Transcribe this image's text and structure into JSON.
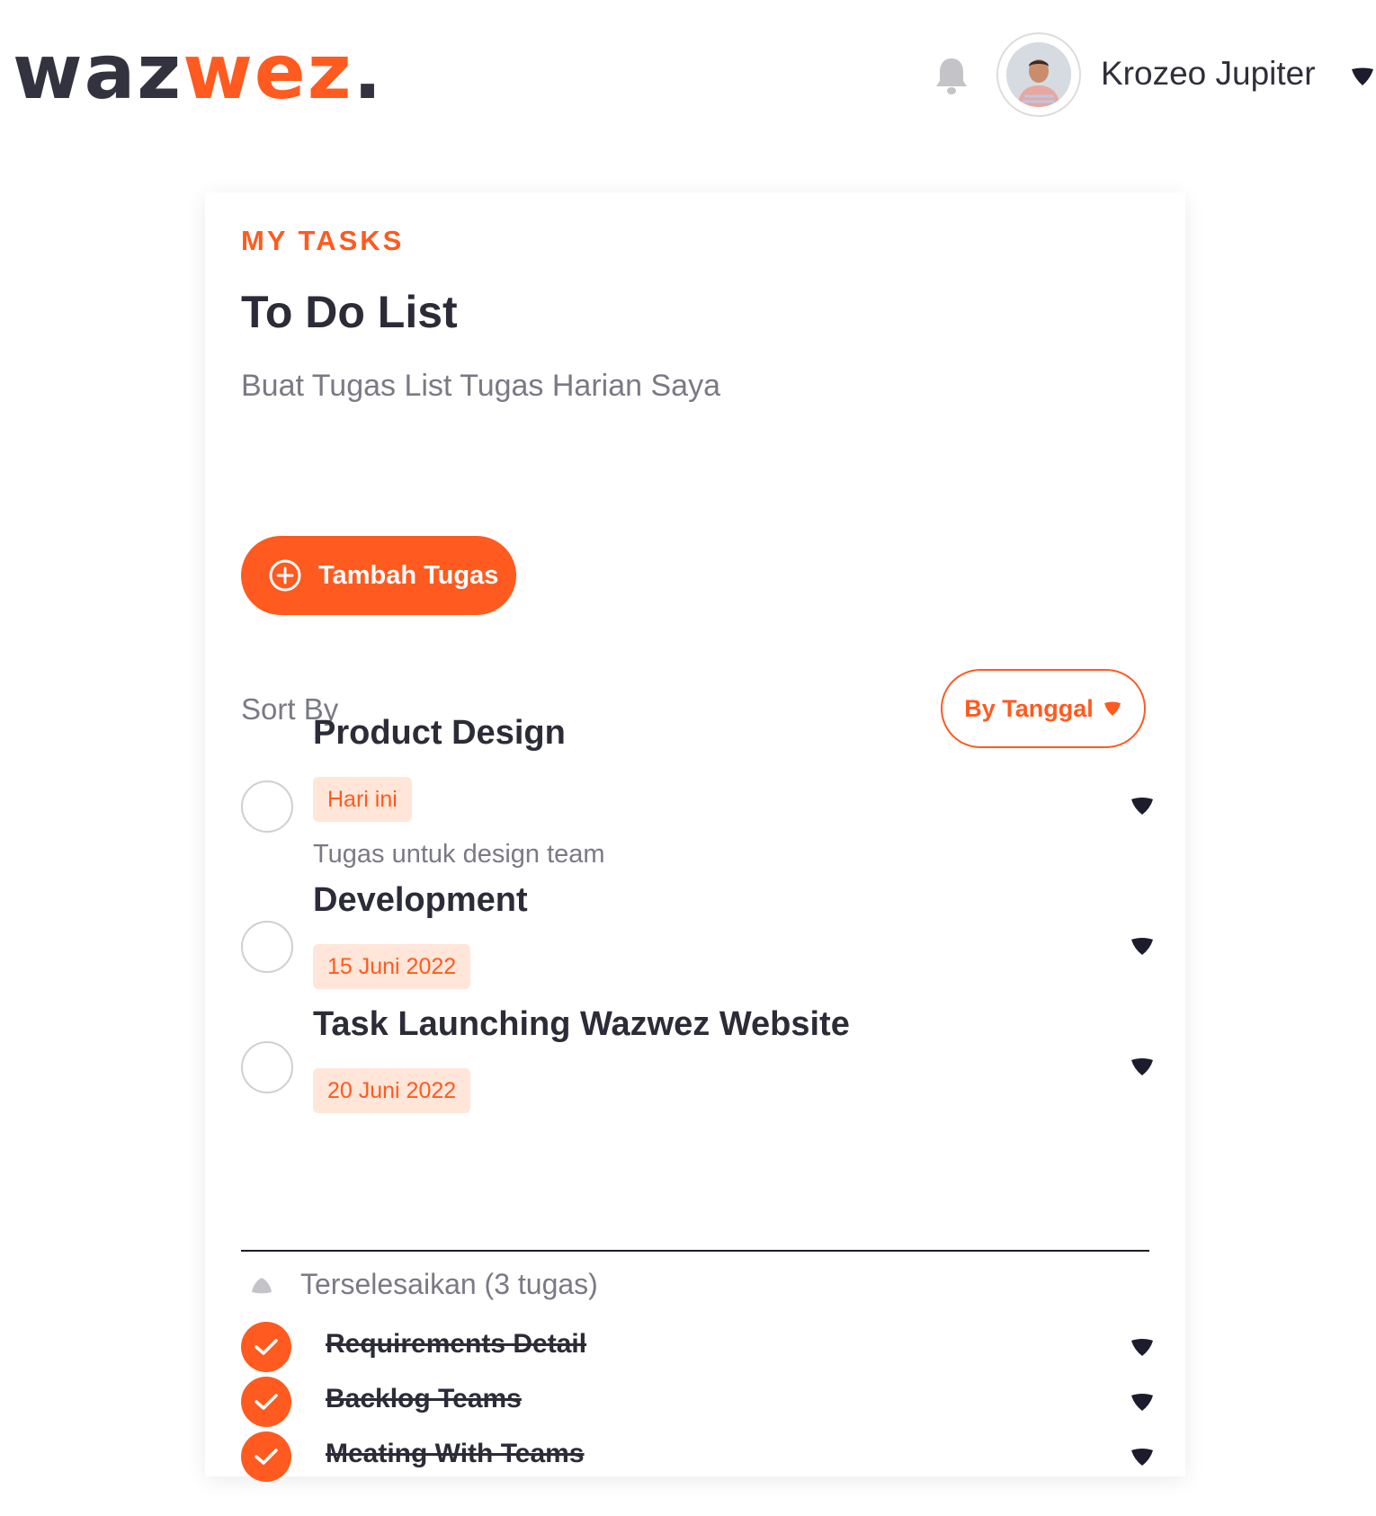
{
  "header": {
    "logo_part1": "waz",
    "logo_part2": "wez",
    "logo_dot": ".",
    "user_name": "Krozeo Jupiter",
    "icons": [
      "bell-icon",
      "avatar",
      "caret-down-icon"
    ]
  },
  "card": {
    "eyebrow": "MY TASKS",
    "title": "To Do List",
    "subtitle": "Buat Tugas List Tugas Harian Saya",
    "add_button_label": "Tambah Tugas",
    "sort_label": "Sort By",
    "sort_value": "By Tanggal"
  },
  "tasks": [
    {
      "name": "Product Design",
      "date": "Hari ini",
      "description": "Tugas untuk design team"
    },
    {
      "name": "Development",
      "date": "15 Juni 2022"
    },
    {
      "name": "Task Launching Wazwez Website",
      "date": "20 Juni 2022"
    }
  ],
  "completed": {
    "label": "Terselesaikan (3 tugas)",
    "items": [
      {
        "name": "Requirements Detail"
      },
      {
        "name": "Backlog Teams"
      },
      {
        "name": "Meating With Teams"
      }
    ]
  },
  "colors": {
    "accent": "#ff5a1f",
    "chip_bg": "#ffe6d8",
    "text_dark": "#2c2c38",
    "text_muted": "#7a7a85"
  }
}
